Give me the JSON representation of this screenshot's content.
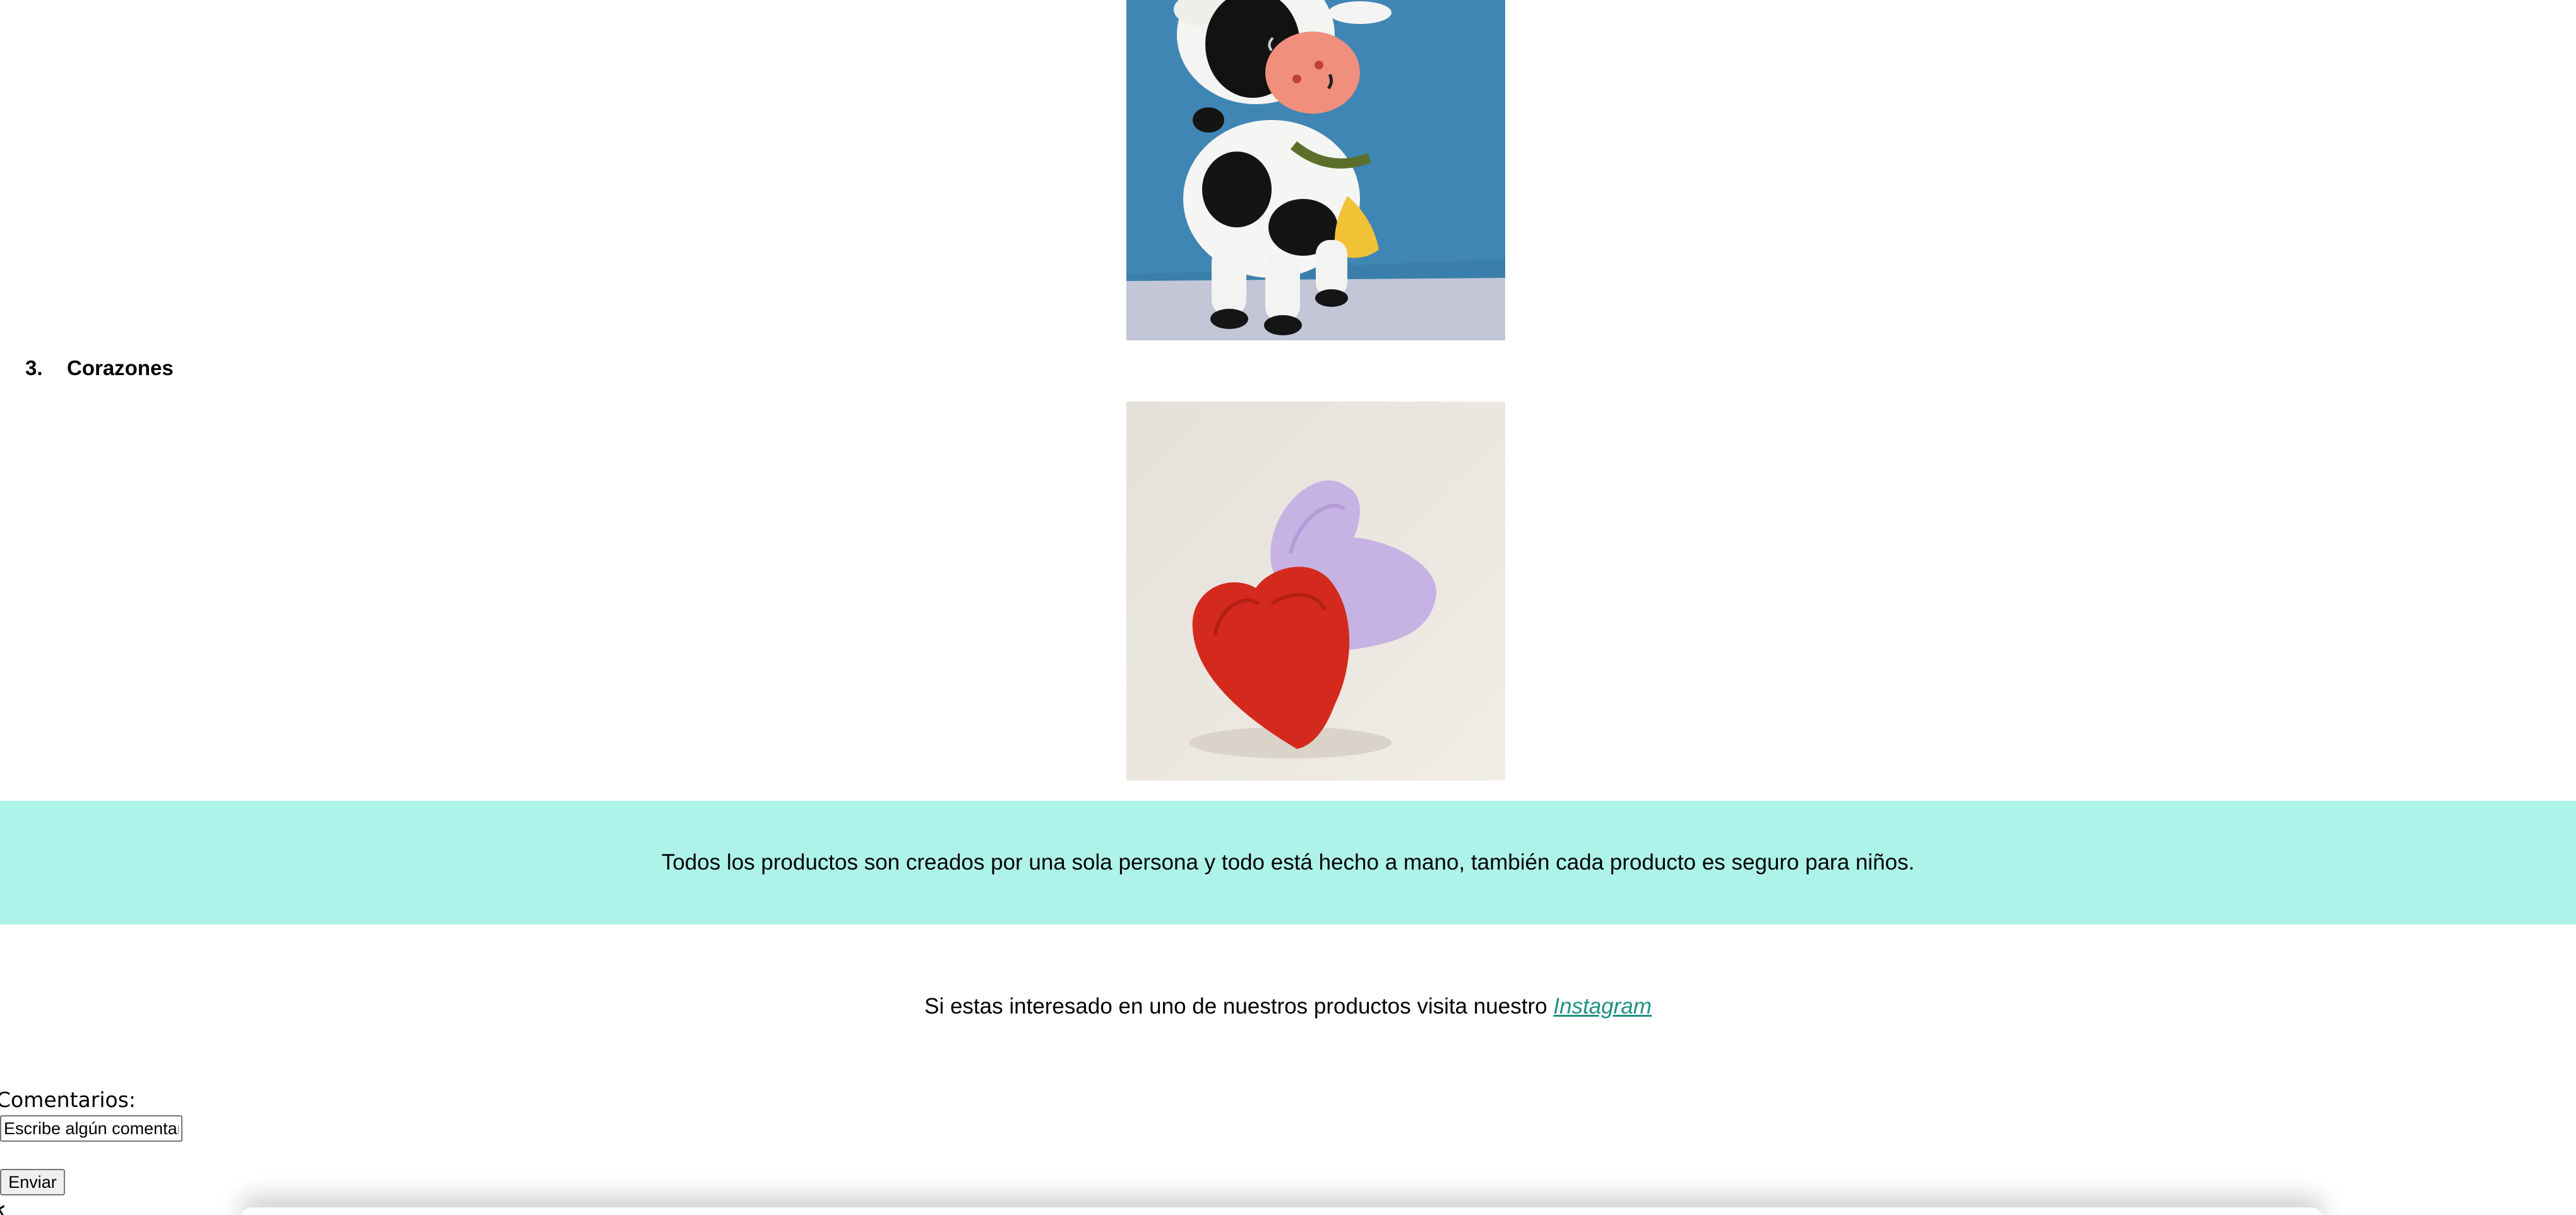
{
  "products": [
    {
      "image_name": "cow-amigurumi-photo"
    },
    {
      "number": "3.",
      "title": "Corazones",
      "image_name": "hearts-amigurumi-photo"
    }
  ],
  "banner": {
    "text": "Todos los productos son creados por una sola persona y todo está hecho a mano, también cada producto es seguro para niños.",
    "background": "#aef3e9"
  },
  "instagram": {
    "prefix": "Si estas interesado en uno de nuestros productos visita nuestro ",
    "link_text": "Instagram",
    "link_color": "#1f9183"
  },
  "comments": {
    "label": "Comentarios:",
    "placeholder": "Escribe algún comentario",
    "submit_label": "Enviar"
  }
}
